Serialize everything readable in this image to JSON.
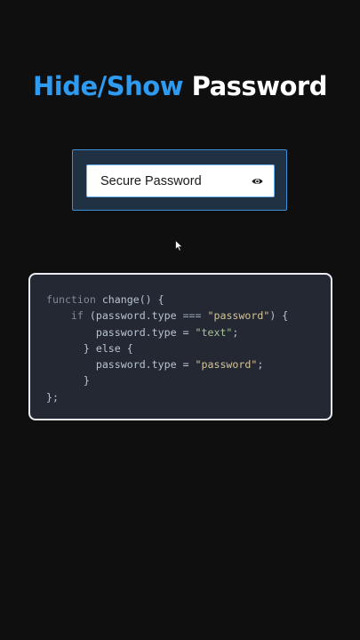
{
  "title": {
    "accent": "Hide/Show",
    "plain": "Password"
  },
  "demo": {
    "password_value": "Secure Password",
    "toggle_icon": "eye-icon",
    "accent_color": "#2f9bf0"
  },
  "code": {
    "lines": [
      {
        "kw": "function",
        "rest": " change() {"
      },
      {
        "indent": "    ",
        "kw": "if",
        "rest": " (password.type ",
        "op": "===",
        "tail": " ",
        "str": "\"password\"",
        "end": ") {"
      },
      {
        "indent": "        ",
        "rest": "password.type = ",
        "str": "\"text\"",
        "end": ";"
      },
      {
        "indent": "      ",
        "rest": "} else {"
      },
      {
        "indent": "        ",
        "rest": "password.type = ",
        "str": "\"password\"",
        "end": ";"
      },
      {
        "indent": "      ",
        "rest": "}"
      },
      {
        "rest": "};"
      }
    ]
  }
}
